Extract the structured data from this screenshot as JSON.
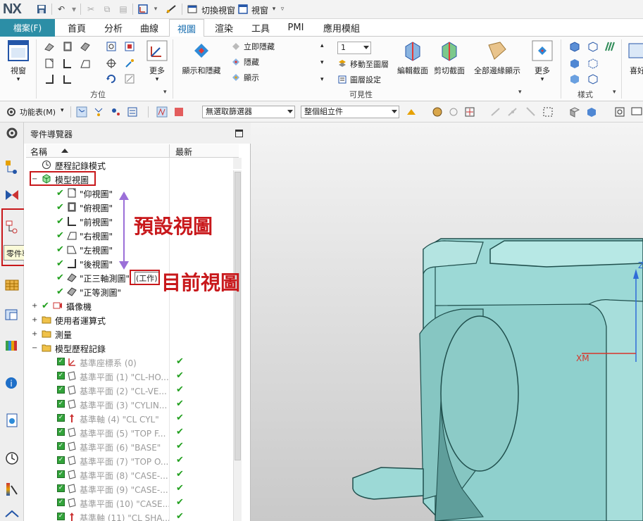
{
  "app": {
    "logo": "NX"
  },
  "quick_access": {
    "switch_window": "切換視窗",
    "window": "視窗"
  },
  "tabs": {
    "file": "檔案(F)",
    "items": [
      "首頁",
      "分析",
      "曲線",
      "視圖",
      "渲染",
      "工具",
      "PMI",
      "應用模組"
    ],
    "active": "視圖"
  },
  "ribbon": {
    "view_button": "視窗",
    "orient_group": "方位",
    "more_1": "更多",
    "show_hide": "顯示和隱藏",
    "instant_hide": "立即隱藏",
    "hide": "隱藏",
    "show": "顯示",
    "layer_value": "1",
    "move_to_layer": "移動至圖層",
    "layer_settings": "圖層設定",
    "visibility_group": "可見性",
    "edit_section": "編輯截面",
    "clip_section": "剪切截面",
    "show_all_faces": "全部邊緣顯示",
    "more_2": "更多",
    "style_group": "樣式",
    "cut_label": "喜好"
  },
  "toolbar2": {
    "menu_label": "功能表(M)",
    "filter_combo": "無選取篩選器",
    "assembly_combo": "整個組立件"
  },
  "navigator": {
    "title": "零件導覽器",
    "col_name": "名稱",
    "col_latest": "最新",
    "tooltip": "零件導覽器",
    "rows": [
      {
        "label": "歷程記錄模式"
      },
      {
        "label": "模型視圖"
      },
      {
        "label": "\"仰視圖\""
      },
      {
        "label": "\"俯視圖\""
      },
      {
        "label": "\"前視圖\""
      },
      {
        "label": "\"右視圖\""
      },
      {
        "label": "\"左視圖\""
      },
      {
        "label": "\"後視圖\""
      },
      {
        "label": "\"正三軸測圖\""
      },
      {
        "label": "\"正等測圖\""
      },
      {
        "label": "攝像機"
      },
      {
        "label": "使用者運算式"
      },
      {
        "label": "測量"
      },
      {
        "label": "模型歷程記錄"
      },
      {
        "label": "基準座標系 (0)"
      },
      {
        "label": "基準平面 (1) \"CL-HO..."
      },
      {
        "label": "基準平面 (2) \"CL-VE..."
      },
      {
        "label": "基準平面 (3) \"CYLIN..."
      },
      {
        "label": "基準軸 (4) \"CL CYL\""
      },
      {
        "label": "基準平面 (5) \"TOP F..."
      },
      {
        "label": "基準平面 (6) \"BASE\""
      },
      {
        "label": "基準平面 (7) \"TOP O..."
      },
      {
        "label": "基準平面 (8) \"CASE-..."
      },
      {
        "label": "基準平面 (9) \"CASE-..."
      },
      {
        "label": "基準平面 (10) \"CASE..."
      },
      {
        "label": "基準軸 (11) \"CL SHA..."
      }
    ],
    "work_tag": "(工作)"
  },
  "annotations": {
    "default_views": "預設視圖",
    "current_view": "目前視圖"
  },
  "graphics": {
    "axis_z": "Z",
    "axis_x": "XM"
  },
  "colors": {
    "file_tab": "#2c8ea6",
    "annotation_red": "#c8181b",
    "part_fill": "#9cd9d6",
    "arrow_purple": "#9b6fd8"
  }
}
